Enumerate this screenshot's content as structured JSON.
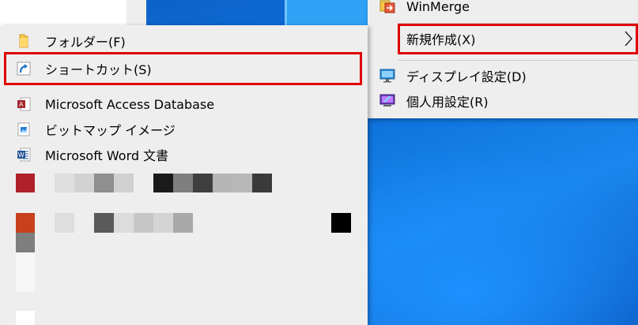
{
  "parent_menu": {
    "items": [
      {
        "label": "WinMerge",
        "icon": "winmerge-icon"
      },
      {
        "label": "新規作成(X)",
        "icon": "",
        "has_submenu": true
      },
      {
        "label": "ディスプレイ設定(D)",
        "icon": "display-settings-icon"
      },
      {
        "label": "個人用設定(R)",
        "icon": "personalize-icon"
      }
    ]
  },
  "submenu": {
    "items": [
      {
        "label": "フォルダー(F)",
        "icon": "folder-icon"
      },
      {
        "label": "ショートカット(S)",
        "icon": "shortcut-icon"
      },
      {
        "label": "Microsoft Access Database",
        "icon": "access-icon"
      },
      {
        "label": "ビットマップ イメージ",
        "icon": "bitmap-icon"
      },
      {
        "label": "Microsoft Word 文書",
        "icon": "word-icon"
      }
    ]
  },
  "colors": {
    "highlight_border": "#e00000",
    "menu_bg": "#eeeeee",
    "desktop_blue": "#0f6fd6"
  }
}
